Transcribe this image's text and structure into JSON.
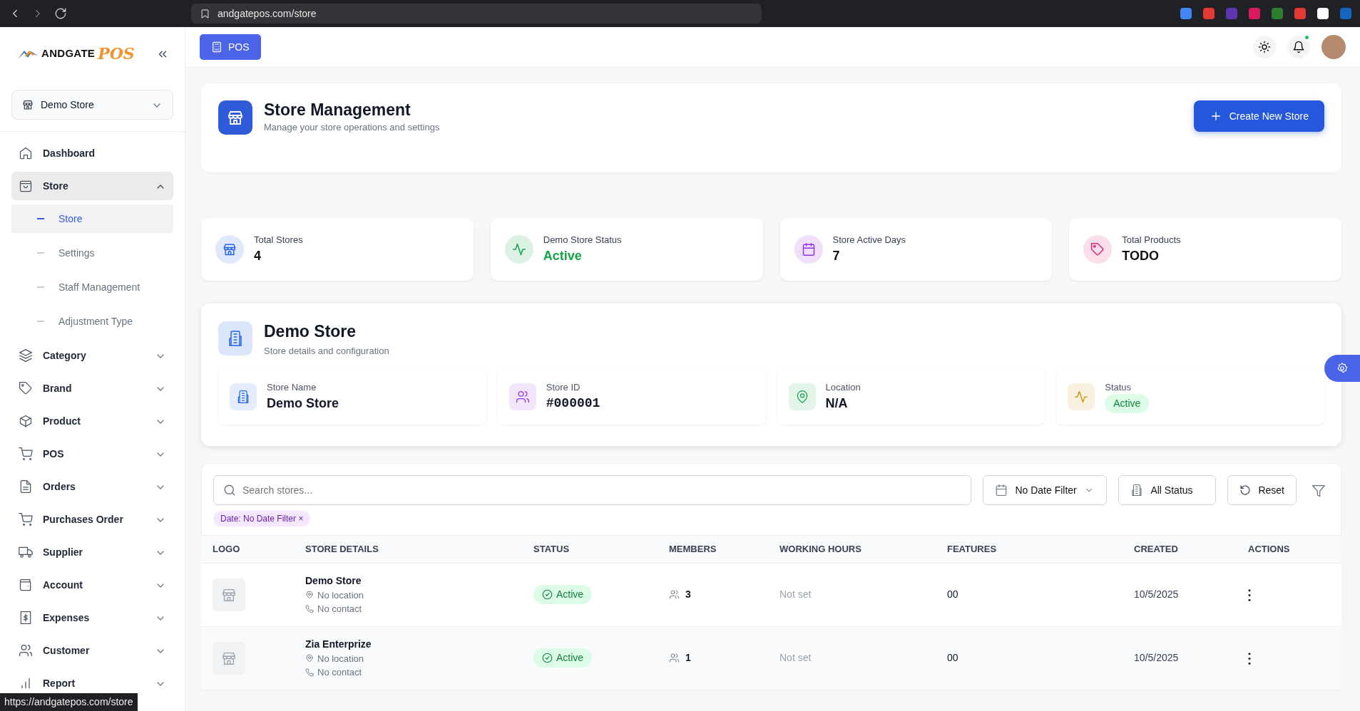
{
  "browser": {
    "url": "andgatepos.com/store",
    "status_url": "https://andgatepos.com/store"
  },
  "sidebar": {
    "logo": {
      "main": "ANDGATE",
      "accent": "POS"
    },
    "store_select": "Demo Store",
    "items": [
      {
        "label": "Dashboard",
        "kind": "link",
        "selected": false
      },
      {
        "label": "Store",
        "kind": "group",
        "expanded": true,
        "selected": true,
        "children": [
          {
            "label": "Store",
            "selected": true
          },
          {
            "label": "Settings",
            "selected": false
          },
          {
            "label": "Staff Management",
            "selected": false
          },
          {
            "label": "Adjustment Type",
            "selected": false
          }
        ]
      },
      {
        "label": "Category",
        "kind": "group",
        "expanded": false,
        "selected": false
      },
      {
        "label": "Brand",
        "kind": "group",
        "expanded": false,
        "selected": false
      },
      {
        "label": "Product",
        "kind": "group",
        "expanded": false,
        "selected": false
      },
      {
        "label": "POS",
        "kind": "group",
        "expanded": false,
        "selected": false
      },
      {
        "label": "Orders",
        "kind": "group",
        "expanded": false,
        "selected": false
      },
      {
        "label": "Purchases Order",
        "kind": "group",
        "expanded": false,
        "selected": false
      },
      {
        "label": "Supplier",
        "kind": "group",
        "expanded": false,
        "selected": false
      },
      {
        "label": "Account",
        "kind": "group",
        "expanded": false,
        "selected": false
      },
      {
        "label": "Expenses",
        "kind": "group",
        "expanded": false,
        "selected": false
      },
      {
        "label": "Customer",
        "kind": "group",
        "expanded": false,
        "selected": false
      },
      {
        "label": "Report",
        "kind": "group",
        "expanded": false,
        "selected": false
      }
    ]
  },
  "topbar": {
    "pos_button": "POS",
    "notification_dot": true
  },
  "page_header": {
    "title": "Store Management",
    "subtitle": "Manage your store operations and settings",
    "create_button": "Create New Store"
  },
  "stats": [
    {
      "label": "Total Stores",
      "value": "4",
      "color": "#2563eb",
      "kind": "plain"
    },
    {
      "label": "Demo Store Status",
      "value": "Active",
      "color": "#16a34a",
      "kind": "status"
    },
    {
      "label": "Store Active Days",
      "value": "7",
      "color": "#9333ea",
      "kind": "plain"
    },
    {
      "label": "Total Products",
      "value": "TODO",
      "color": "#db2777",
      "kind": "plain"
    }
  ],
  "store_details": {
    "title": "Demo Store",
    "subtitle": "Store details and configuration",
    "fields": [
      {
        "label": "Store Name",
        "value": "Demo Store",
        "kind": "text",
        "color": "#2563eb"
      },
      {
        "label": "Store ID",
        "value": "#000001",
        "kind": "mono",
        "color": "#9333ea"
      },
      {
        "label": "Location",
        "value": "N/A",
        "kind": "text",
        "color": "#16a34a"
      },
      {
        "label": "Status",
        "value": "Active",
        "kind": "badge",
        "color": "#ca8a04"
      }
    ]
  },
  "filters": {
    "search_placeholder": "Search stores...",
    "date_filter": "No Date Filter",
    "status_filter": "All Status",
    "reset": "Reset",
    "chips": [
      {
        "label": "Date: No Date Filter",
        "close": "×"
      }
    ]
  },
  "table": {
    "columns": [
      "LOGO",
      "STORE DETAILS",
      "STATUS",
      "MEMBERS",
      "WORKING HOURS",
      "FEATURES",
      "CREATED",
      "ACTIONS"
    ],
    "rows": [
      {
        "name": "Demo Store",
        "location": "No location",
        "contact": "No contact",
        "status": "Active",
        "members": "3",
        "working_hours": "Not set",
        "features": "00",
        "created": "10/5/2025"
      },
      {
        "name": "Zia Enterprize",
        "location": "No location",
        "contact": "No contact",
        "status": "Active",
        "members": "1",
        "working_hours": "Not set",
        "features": "00",
        "created": "10/5/2025"
      }
    ]
  }
}
